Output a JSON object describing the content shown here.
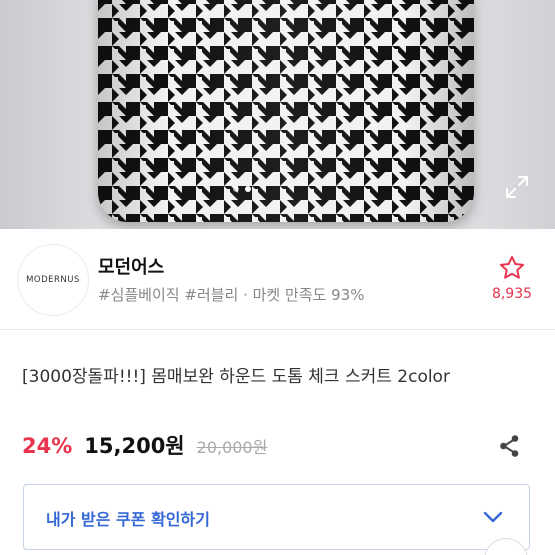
{
  "product_image": {
    "alt": "houndstooth check skirt",
    "slide_count": 2,
    "active_slide": 2,
    "icon": "expand-icon"
  },
  "seller": {
    "logo_text": "MODERNUS",
    "name": "모던어스",
    "tags": "#심플베이직 #러블리 · 마켓 만족도 93%",
    "like_icon": "star-outline-icon",
    "like_count": "8,935"
  },
  "product": {
    "title": "[3000장돌파!!!] 몸매보완 하운드 도톰 체크 스커트 2color",
    "discount": "24%",
    "price": "15,200원",
    "original_price": "20,000원",
    "share_icon": "share-icon"
  },
  "coupon": {
    "label": "내가 받은 쿠폰 확인하기",
    "icon": "chevron-down-icon"
  },
  "colors": {
    "accent_red": "#e8344e",
    "accent_blue": "#3568d4"
  }
}
